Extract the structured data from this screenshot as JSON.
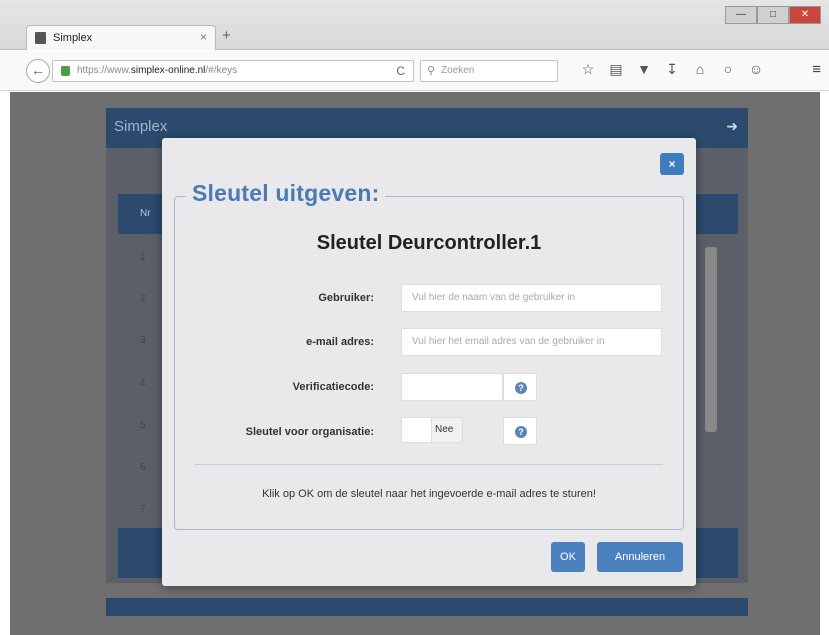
{
  "browser": {
    "tab_title": "Simplex",
    "tab_close": "×",
    "new_tab": "+",
    "url_prefix": "https://www.",
    "url_domain": "simplex-online.nl",
    "url_path": "/#/keys",
    "search_placeholder": "Zoeken",
    "window_controls": [
      "—",
      "□",
      "✕"
    ]
  },
  "app": {
    "title": "Simplex",
    "table_header_nr": "Nr",
    "row_numbers": [
      "1",
      "2",
      "3",
      "4",
      "5",
      "6",
      "7"
    ]
  },
  "dialog": {
    "legend": "Sleutel uitgeven:",
    "key_title": "Sleutel Deurcontroller.1",
    "fields": {
      "user_label": "Gebruiker:",
      "user_placeholder": "Vul hier de naam van de gebruiker in",
      "email_label": "e-mail adres:",
      "email_placeholder": "Vul hier het email adres van de gebruiker in",
      "code_label": "Verificatiecode:",
      "org_label": "Sleutel voor organisatie:",
      "org_value": "Nee"
    },
    "info": "Klik op OK om de sleutel naar het ingevoerde e-mail adres te sturen!",
    "ok_label": "OK",
    "cancel_label": "Annuleren",
    "close_label": "×"
  },
  "colors": {
    "accent": "#4b80bf",
    "header_navy": "#2b4a6d",
    "legend_blue": "#4a7ab3"
  }
}
